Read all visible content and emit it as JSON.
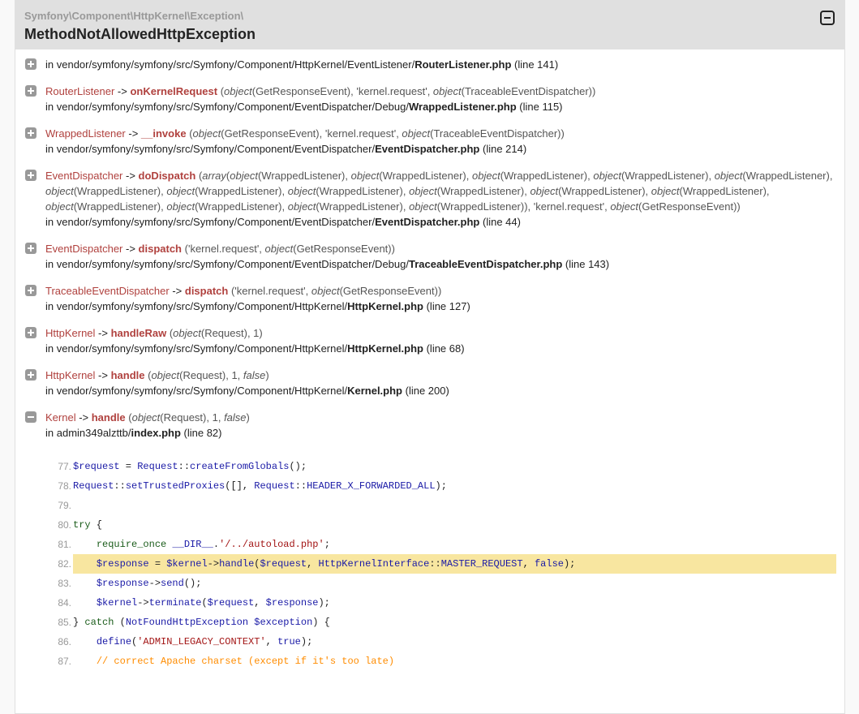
{
  "exception": {
    "namespace": "Symfony\\Component\\HttpKernel\\Exception\\",
    "class": "MethodNotAllowedHttpException"
  },
  "traces": [
    {
      "collapsed": true,
      "class": "",
      "method": "",
      "args_html": "",
      "path": "in vendor/symfony/symfony/src/Symfony/Component/HttpKernel/EventListener/",
      "file": "RouterListener.php",
      "line": "(line 141)"
    },
    {
      "collapsed": true,
      "class": "RouterListener",
      "method": "onKernelRequest",
      "args_html": "(<i>object</i>(GetResponseEvent), 'kernel.request', <i>object</i>(TraceableEventDispatcher))",
      "path": "in vendor/symfony/symfony/src/Symfony/Component/EventDispatcher/Debug/",
      "file": "WrappedListener.php",
      "line": "(line 115)"
    },
    {
      "collapsed": true,
      "class": "WrappedListener",
      "method": "__invoke",
      "args_html": "(<i>object</i>(GetResponseEvent), 'kernel.request', <i>object</i>(TraceableEventDispatcher))",
      "path": "in vendor/symfony/symfony/src/Symfony/Component/EventDispatcher/",
      "file": "EventDispatcher.php",
      "line": "(line 214)"
    },
    {
      "collapsed": true,
      "class": "EventDispatcher",
      "method": "doDispatch",
      "args_html": "(<i>array</i>(<i>object</i>(WrappedListener), <i>object</i>(WrappedListener), <i>object</i>(WrappedListener), <i>object</i>(WrappedListener), <i>object</i>(WrappedListener), <i>object</i>(WrappedListener), <i>object</i>(WrappedListener), <i>object</i>(WrappedListener), <i>object</i>(WrappedListener), <i>object</i>(WrappedListener), <i>object</i>(WrappedListener), <i>object</i>(WrappedListener), <i>object</i>(WrappedListener), <i>object</i>(WrappedListener), <i>object</i>(WrappedListener)), 'kernel.request', <i>object</i>(GetResponseEvent))",
      "path": "in vendor/symfony/symfony/src/Symfony/Component/EventDispatcher/",
      "file": "EventDispatcher.php",
      "line": "(line 44)"
    },
    {
      "collapsed": true,
      "class": "EventDispatcher",
      "method": "dispatch",
      "args_html": "('kernel.request', <i>object</i>(GetResponseEvent))",
      "path": "in vendor/symfony/symfony/src/Symfony/Component/EventDispatcher/Debug/",
      "file": "TraceableEventDispatcher.php",
      "line": "(line 143)"
    },
    {
      "collapsed": true,
      "class": "TraceableEventDispatcher",
      "method": "dispatch",
      "args_html": "('kernel.request', <i>object</i>(GetResponseEvent))",
      "path": "in vendor/symfony/symfony/src/Symfony/Component/HttpKernel/",
      "file": "HttpKernel.php",
      "line": "(line 127)"
    },
    {
      "collapsed": true,
      "class": "HttpKernel",
      "method": "handleRaw",
      "args_html": "(<i>object</i>(Request), 1)",
      "path": "in vendor/symfony/symfony/src/Symfony/Component/HttpKernel/",
      "file": "HttpKernel.php",
      "line": "(line 68)"
    },
    {
      "collapsed": true,
      "class": "HttpKernel",
      "method": "handle",
      "args_html": "(<i>object</i>(Request), 1, <i>false</i>)",
      "path": "in vendor/symfony/symfony/src/Symfony/Component/HttpKernel/",
      "file": "Kernel.php",
      "line": "(line 200)"
    },
    {
      "collapsed": false,
      "class": "Kernel",
      "method": "handle",
      "args_html": "(<i>object</i>(Request), 1, <i>false</i>)",
      "path": "in admin349alzttb/",
      "file": "index.php",
      "line": "(line 82)"
    }
  ],
  "code": [
    {
      "n": "77.",
      "html": "<span class=\"var\">$request</span> = <span class=\"var\">Request</span>::<span class=\"var\">createFromGlobals</span>();",
      "hl": false
    },
    {
      "n": "78.",
      "html": "<span class=\"var\">Request</span>::<span class=\"var\">setTrustedProxies</span>([], <span class=\"var\">Request</span>::<span class=\"var\">HEADER_X_FORWARDED_ALL</span>);",
      "hl": false
    },
    {
      "n": "79.",
      "html": "",
      "hl": false
    },
    {
      "n": "80.",
      "html": "<span class=\"kw\">try</span> {",
      "hl": false
    },
    {
      "n": "81.",
      "html": "    <span class=\"kw\">require_once</span> <span class=\"var\">__DIR__</span>.<span class=\"str\">'/../autoload.php'</span>;",
      "hl": false
    },
    {
      "n": "82.",
      "html": "    <span class=\"var\">$response</span> = <span class=\"var\">$kernel</span>-><span class=\"var\">handle</span>(<span class=\"var\">$request</span>, <span class=\"var\">HttpKernelInterface</span>::<span class=\"var\">MASTER_REQUEST</span>, <span class=\"var\">false</span>);",
      "hl": true
    },
    {
      "n": "83.",
      "html": "    <span class=\"var\">$response</span>-><span class=\"var\">send</span>();",
      "hl": false
    },
    {
      "n": "84.",
      "html": "    <span class=\"var\">$kernel</span>-><span class=\"var\">terminate</span>(<span class=\"var\">$request</span>, <span class=\"var\">$response</span>);",
      "hl": false
    },
    {
      "n": "85.",
      "html": "} <span class=\"kw\">catch</span> (<span class=\"var\">NotFoundHttpException</span> <span class=\"var\">$exception</span>) {",
      "hl": false
    },
    {
      "n": "86.",
      "html": "    <span class=\"var\">define</span>(<span class=\"str\">'ADMIN_LEGACY_CONTEXT'</span>, <span class=\"var\">true</span>);",
      "hl": false
    },
    {
      "n": "87.",
      "html": "    <span class=\"cmt\">// correct Apache charset (except if it's too late)</span>",
      "hl": false
    }
  ]
}
